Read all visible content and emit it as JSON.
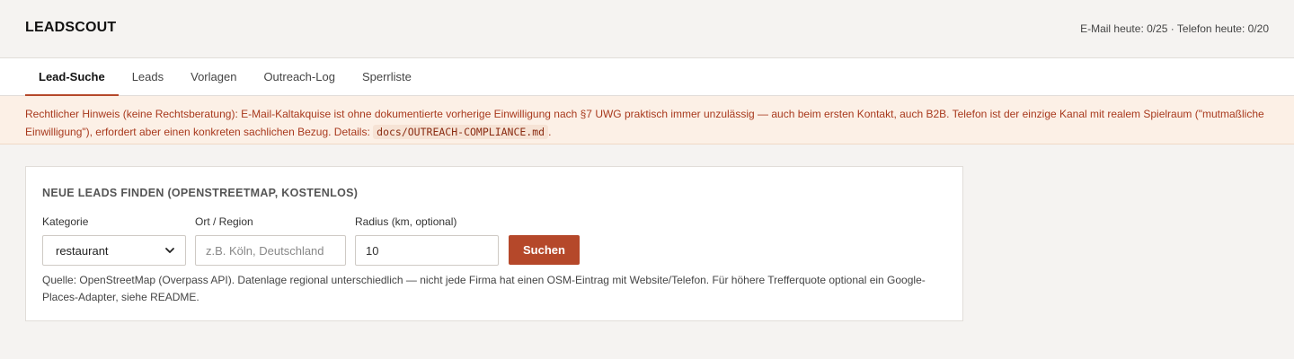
{
  "header": {
    "title": "LEADSCOUT",
    "quota": "E-Mail heute: 0/25 · Telefon heute: 0/20"
  },
  "tabs": [
    {
      "label": "Lead-Suche",
      "active": true
    },
    {
      "label": "Leads",
      "active": false
    },
    {
      "label": "Vorlagen",
      "active": false
    },
    {
      "label": "Outreach-Log",
      "active": false
    },
    {
      "label": "Sperrliste",
      "active": false
    }
  ],
  "notice": {
    "text": "Rechtlicher Hinweis (keine Rechtsberatung): E-Mail-Kaltakquise ist ohne dokumentierte vorherige Einwilligung nach §7 UWG praktisch immer unzulässig — auch beim ersten Kontakt, auch B2B. Telefon ist der einzige Kanal mit realem Spielraum (\"mutmaßliche Einwilligung\"), erfordert aber einen konkreten sachlichen Bezug. Details: ",
    "code": "docs/OUTREACH-COMPLIANCE.md",
    "suffix": "."
  },
  "search": {
    "title": "NEUE LEADS FINDEN (OPENSTREETMAP, KOSTENLOS)",
    "category_label": "Kategorie",
    "category_value": "restaurant",
    "location_label": "Ort / Region",
    "location_placeholder": "z.B. Köln, Deutschland",
    "location_value": "",
    "radius_label": "Radius (km, optional)",
    "radius_value": "10",
    "submit_label": "Suchen",
    "source_note": "Quelle: OpenStreetMap (Overpass API). Datenlage regional unterschiedlich — nicht jede Firma hat einen OSM-Eintrag mit Website/Telefon. Für höhere Trefferquote optional ein Google-Places-Adapter, siehe README."
  },
  "colors": {
    "accent": "#b5482a",
    "notice_bg": "#fcf0e6",
    "notice_text": "#a8391d",
    "page_bg": "#f5f3f1"
  },
  "icons": {
    "select_chevron": "chevron-down-icon"
  }
}
